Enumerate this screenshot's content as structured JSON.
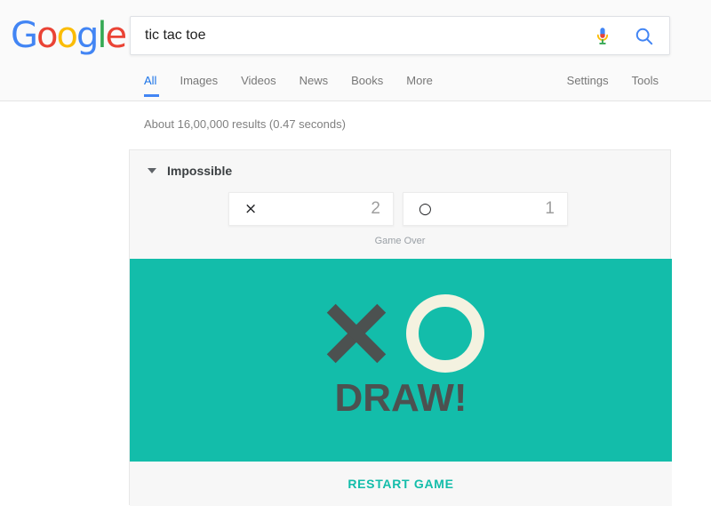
{
  "header": {
    "logo": {
      "name": "Google",
      "letters": [
        {
          "ch": "G",
          "color": "#4285F4"
        },
        {
          "ch": "o",
          "color": "#EA4335"
        },
        {
          "ch": "o",
          "color": "#FBBC05"
        },
        {
          "ch": "g",
          "color": "#4285F4"
        },
        {
          "ch": "l",
          "color": "#34A853"
        },
        {
          "ch": "e",
          "color": "#EA4335"
        }
      ]
    },
    "search": {
      "value": "tic tac toe",
      "placeholder": "Search",
      "mic_icon": "microphone-icon",
      "search_icon": "search-icon"
    },
    "nav_left": [
      {
        "label": "All",
        "active": true
      },
      {
        "label": "Images",
        "active": false
      },
      {
        "label": "Videos",
        "active": false
      },
      {
        "label": "News",
        "active": false
      },
      {
        "label": "Books",
        "active": false
      },
      {
        "label": "More",
        "active": false
      }
    ],
    "nav_right": [
      {
        "label": "Settings"
      },
      {
        "label": "Tools"
      }
    ]
  },
  "results": {
    "stats": "About 16,00,000 results (0.47 seconds)"
  },
  "game_card": {
    "difficulty": {
      "label": "Impossible",
      "caret_icon": "chevron-down-icon"
    },
    "scores": [
      {
        "mark": "×",
        "mark_name": "x-mark",
        "value": "2"
      },
      {
        "mark": "○",
        "mark_name": "o-mark",
        "value": "1"
      }
    ],
    "status": "Game Over",
    "board": {
      "background_color": "#13bdaa",
      "x_color": "#4c5150",
      "o_color": "#f4f2e0",
      "result_text": "DRAW!",
      "result_color": "#4c5150"
    },
    "restart": {
      "label": "RESTART GAME",
      "color": "#13bdaa"
    }
  }
}
